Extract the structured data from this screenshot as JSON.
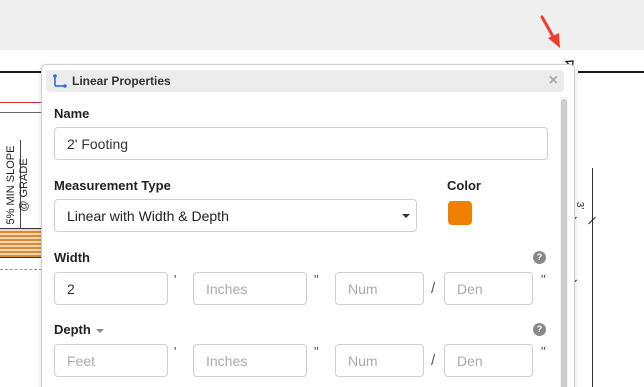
{
  "background": {
    "slope_text": "5% MIN SLOPE @ GRADE",
    "dim_text": "3'"
  },
  "dialog": {
    "title": "Linear Properties",
    "close_glyph": "×",
    "name": {
      "label": "Name",
      "value": "2' Footing"
    },
    "measurement_type": {
      "label": "Measurement Type",
      "value": "Linear with Width & Depth"
    },
    "color": {
      "label": "Color",
      "value": "#f07f00"
    },
    "width": {
      "label": "Width",
      "feet_value": "2",
      "inches_placeholder": "Inches",
      "num_placeholder": "Num",
      "den_placeholder": "Den",
      "feet_mark": "'",
      "inch_mark": "\"",
      "slash": "/"
    },
    "depth": {
      "label": "Depth",
      "feet_placeholder": "Feet",
      "inches_placeholder": "Inches",
      "num_placeholder": "Num",
      "den_placeholder": "Den",
      "feet_mark": "'",
      "inch_mark": "\"",
      "slash": "/"
    },
    "help_glyph": "?"
  },
  "accent_colors": {
    "arrow": "#f03c2e",
    "title_icon": "#2f6fd6"
  }
}
